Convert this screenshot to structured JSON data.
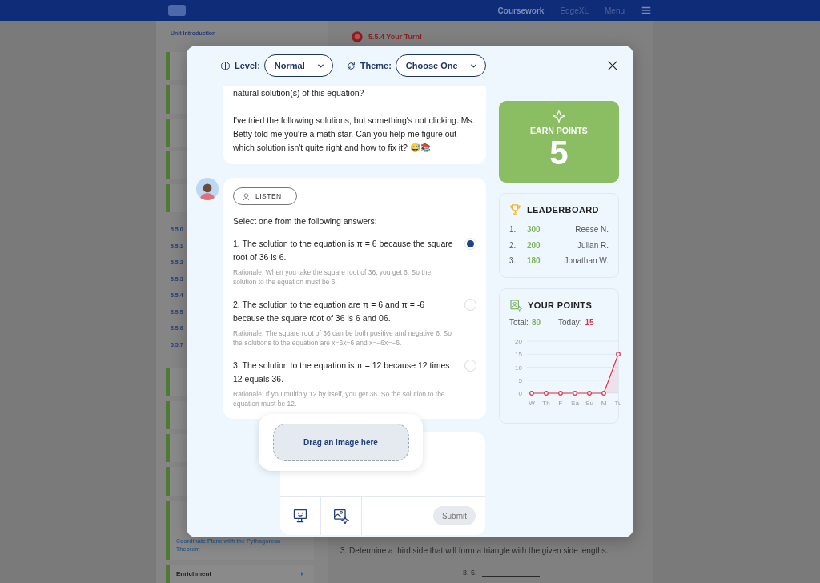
{
  "background": {
    "nav": {
      "links": [
        "Coursework",
        "EdgeXL",
        "Menu"
      ]
    },
    "sidebar": {
      "heading": "Unit Introduction",
      "items": [
        {
          "kind": "lesson"
        },
        {
          "kind": "lesson"
        },
        {
          "kind": "lesson"
        },
        {
          "kind": "lesson"
        },
        {
          "kind": "lesson"
        },
        {
          "kind": "link",
          "text": "5.5.0"
        },
        {
          "kind": "link",
          "text": "5.5.1"
        },
        {
          "kind": "link",
          "text": "5.5.2"
        },
        {
          "kind": "link",
          "text": "5.5.3"
        },
        {
          "kind": "link",
          "text": "5.5.4"
        },
        {
          "kind": "link",
          "text": "5.5.5"
        },
        {
          "kind": "link",
          "text": "5.5.6"
        },
        {
          "kind": "link",
          "text": "5.5.7"
        },
        {
          "kind": "lesson"
        },
        {
          "kind": "lesson"
        },
        {
          "kind": "lesson"
        },
        {
          "kind": "lesson"
        },
        {
          "kind": "lesson",
          "text": "Coordinate Plane with the Pythagorean Theorem"
        },
        {
          "kind": "section",
          "text": "Enrichment"
        }
      ]
    },
    "content": {
      "title": "5.5.4 Your Turn!",
      "question": "3. Determine a third side that will form a triangle with the given side lengths.",
      "answer_prefix": "8, 5,"
    }
  },
  "modal": {
    "level": {
      "label": "Level:",
      "value": "Normal"
    },
    "theme": {
      "label": "Theme:",
      "value": "Choose One"
    },
    "messages": [
      {
        "kind": "text",
        "paragraphs": [
          "natural solution(s) of this equation?",
          "I've tried the following solutions, but something's not clicking. Ms. Betty told me you're a math star. Can you help me figure out which solution isn't quite right and how to fix it? 😅📚"
        ]
      },
      {
        "kind": "choice",
        "listen": "LISTEN",
        "prompt": "Select one from the following answers:",
        "options": [
          {
            "text": "1. The solution to the equation is π = 6 because the square root of 36 is 6.",
            "rationale": "Rationale: When you take the square root of 36, you get 6. So the solution to the equation must be 6.",
            "selected": true
          },
          {
            "text": "2. The solution to the equation are π = 6 and π = -6 because the square root of 36 is 6 and 06.",
            "rationale": "Rationale: The square root of 36 can be both positive and negative 6. So the solutions to the equation are x=6x=6 and x=−6x=−6.",
            "selected": false
          },
          {
            "text": "3. The solution to the equation is π = 12 because 12 times 12 equals 36.",
            "rationale": "Rationale: If you multiply 12 by itself, you get 36. So the solution to the equation must be 12.",
            "selected": false
          }
        ]
      }
    ],
    "composer": {
      "submit": {
        "label": "Submit",
        "disabled": true
      },
      "drop_hint": "Drag an image here"
    },
    "earn": {
      "label": "EARN POINTS",
      "value": "5"
    },
    "leaderboard": {
      "title": "LEADERBOARD",
      "rows": [
        {
          "rank": "1.",
          "points": "300",
          "name": "Reese N."
        },
        {
          "rank": "2.",
          "points": "200",
          "name": "Julian R."
        },
        {
          "rank": "3.",
          "points": "180",
          "name": "Jonathan W."
        }
      ]
    },
    "your_points": {
      "title": "YOUR POINTS",
      "total_label": "Total:",
      "total": "80",
      "today_label": "Today:",
      "today": "15",
      "chart_data": {
        "type": "area",
        "categories": [
          "W",
          "Th",
          "F",
          "Sa",
          "Su",
          "M",
          "Tu"
        ],
        "series": [
          {
            "color": "#e0314b",
            "values": [
              0,
              0,
              0,
              0,
              0,
              0,
              15
            ]
          }
        ],
        "grid": true,
        "ylim": [
          0,
          20
        ],
        "yticks": [
          0,
          5,
          10,
          15,
          20
        ]
      }
    }
  }
}
